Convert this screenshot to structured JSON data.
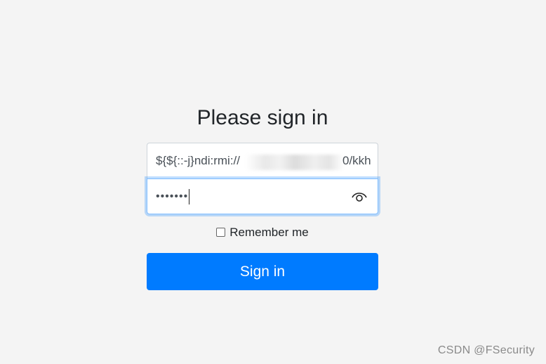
{
  "form": {
    "heading": "Please sign in",
    "username_value": "${${::-j}ndi:rmi://",
    "username_tail": "0/kkh",
    "password_masked": "•••••••",
    "remember_label": "Remember me",
    "remember_checked": false,
    "signin_label": "Sign in"
  },
  "watermark": {
    "text": "CSDN @FSecurity"
  },
  "colors": {
    "background": "#f4f4f4",
    "primary": "#007bff",
    "focus_border": "#80bdff"
  },
  "icons": {
    "password_toggle": "eye-icon"
  }
}
